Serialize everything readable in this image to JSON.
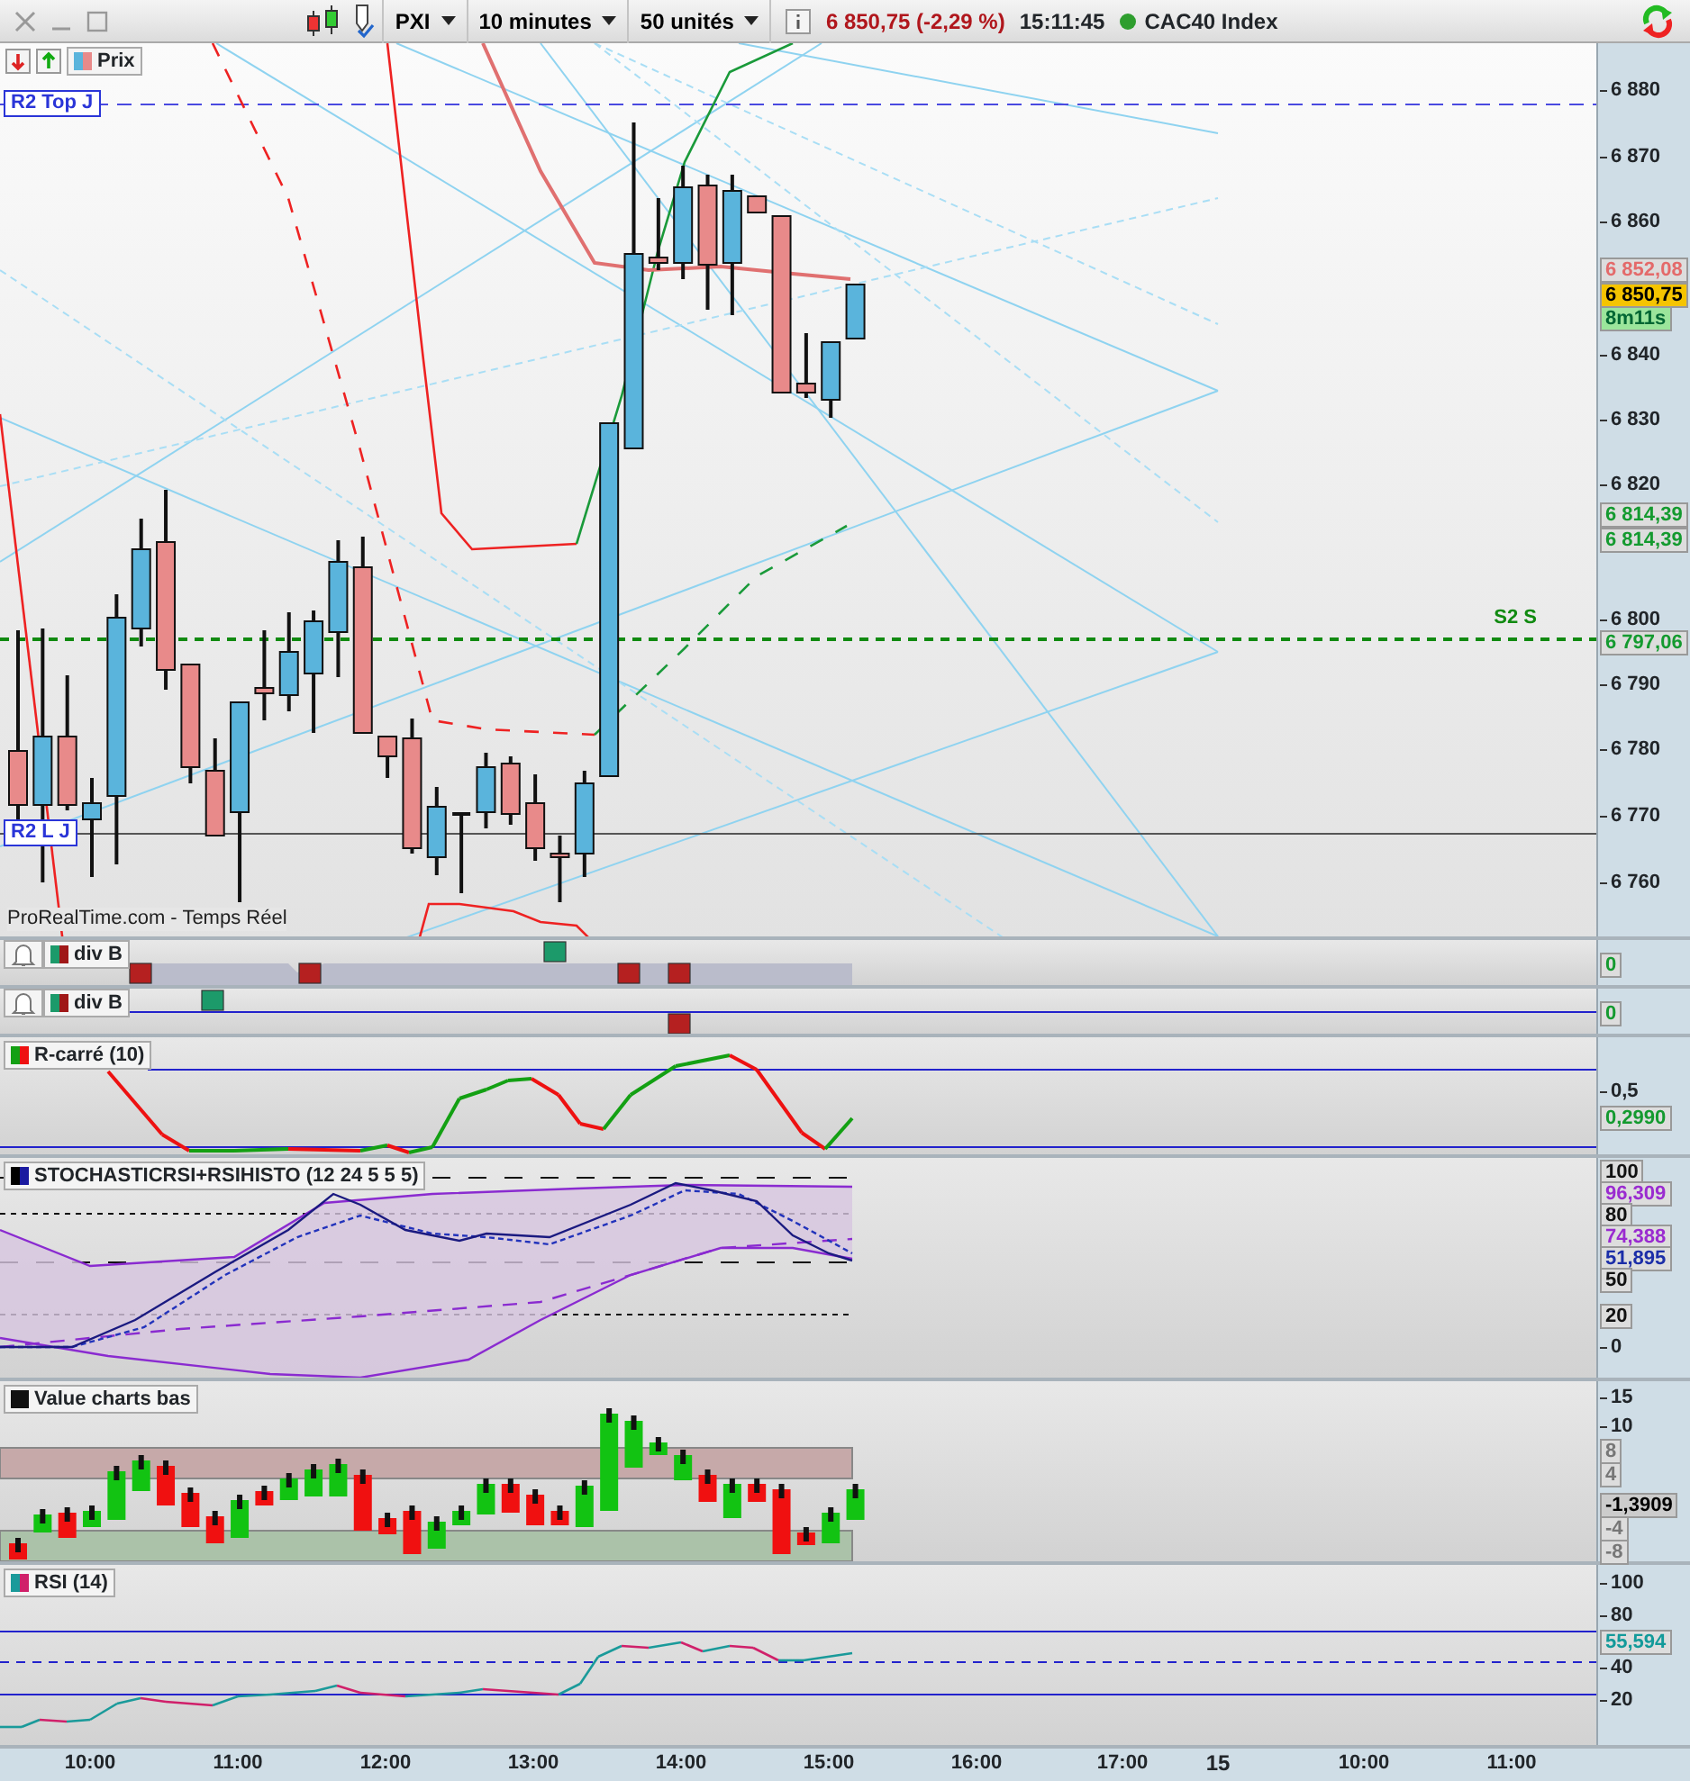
{
  "toolbar": {
    "symbol": "PXI",
    "interval": "10 minutes",
    "units": "50 unités",
    "price_change": "6 850,75 (-2,29 %)",
    "time": "15:11:45",
    "instrument": "CAC40 Index"
  },
  "main_chart": {
    "legend": "Prix",
    "source_label": "ProRealTime.com - Temps Réel",
    "level_labels": [
      {
        "text": "R2 Top J",
        "kind": "resistance"
      },
      {
        "text": "R2 L J",
        "kind": "resistance"
      },
      {
        "text": "S2 S",
        "kind": "support"
      }
    ],
    "axis": [
      {
        "text": "6 880",
        "kind": "tick"
      },
      {
        "text": "6 870",
        "kind": "tick"
      },
      {
        "text": "6 860",
        "kind": "tick"
      },
      {
        "text": "6 852,08",
        "kind": "previous"
      },
      {
        "text": "6 850,75",
        "kind": "current"
      },
      {
        "text": "8m11s",
        "kind": "countdown"
      },
      {
        "text": "6 840",
        "kind": "tick"
      },
      {
        "text": "6 830",
        "kind": "tick"
      },
      {
        "text": "6 820",
        "kind": "tick"
      },
      {
        "text": "6 814,39",
        "kind": "green"
      },
      {
        "text": "6 814,39",
        "kind": "green"
      },
      {
        "text": "6 800",
        "kind": "tick"
      },
      {
        "text": "6 797,06",
        "kind": "green"
      },
      {
        "text": "6 790",
        "kind": "tick"
      },
      {
        "text": "6 780",
        "kind": "tick"
      },
      {
        "text": "6 770",
        "kind": "tick"
      },
      {
        "text": "6 760",
        "kind": "tick"
      }
    ]
  },
  "indicators": [
    {
      "kind": "divergence",
      "title": "div B",
      "axis": [
        {
          "text": "0",
          "kind": "green"
        }
      ]
    },
    {
      "kind": "divergence2",
      "title": "div B",
      "axis": [
        {
          "text": "0",
          "kind": "green"
        }
      ]
    },
    {
      "kind": "rsquare",
      "title": "R-carré (10)",
      "axis": [
        {
          "text": "0,5",
          "kind": "tick"
        },
        {
          "text": "0,2990",
          "kind": "green"
        }
      ]
    },
    {
      "kind": "stochastic",
      "title": "STOCHASTICRSI+RSIHISTO (12 24 5 5 5)",
      "axis": [
        {
          "text": "100",
          "kind": "boxed"
        },
        {
          "text": "96,309",
          "kind": "purple"
        },
        {
          "text": "80",
          "kind": "boxed"
        },
        {
          "text": "74,388",
          "kind": "purple"
        },
        {
          "text": "51,895",
          "kind": "blue"
        },
        {
          "text": "50",
          "kind": "boxed"
        },
        {
          "text": "20",
          "kind": "boxed"
        },
        {
          "text": "0",
          "kind": "tick"
        }
      ]
    },
    {
      "kind": "valuechart",
      "title": "Value charts bas",
      "axis": [
        {
          "text": "15",
          "kind": "tick"
        },
        {
          "text": "10",
          "kind": "tick"
        },
        {
          "text": "8",
          "kind": "grey"
        },
        {
          "text": "4",
          "kind": "grey"
        },
        {
          "text": "-1,3909",
          "kind": "dark"
        },
        {
          "text": "-4",
          "kind": "grey"
        },
        {
          "text": "-8",
          "kind": "grey"
        }
      ]
    },
    {
      "kind": "rsi",
      "title": "RSI (14)",
      "axis": [
        {
          "text": "100",
          "kind": "tick"
        },
        {
          "text": "80",
          "kind": "tick"
        },
        {
          "text": "55,594",
          "kind": "teal"
        },
        {
          "text": "40",
          "kind": "tick"
        },
        {
          "text": "20",
          "kind": "tick"
        }
      ]
    }
  ],
  "time_axis": [
    {
      "text": "10:00",
      "kind": "time"
    },
    {
      "text": "11:00",
      "kind": "time"
    },
    {
      "text": "12:00",
      "kind": "time"
    },
    {
      "text": "13:00",
      "kind": "time"
    },
    {
      "text": "14:00",
      "kind": "time"
    },
    {
      "text": "15:00",
      "kind": "time"
    },
    {
      "text": "16:00",
      "kind": "time"
    },
    {
      "text": "17:00",
      "kind": "time"
    },
    {
      "text": "15",
      "kind": "day"
    },
    {
      "text": "10:00",
      "kind": "time"
    },
    {
      "text": "11:00",
      "kind": "time"
    }
  ]
}
